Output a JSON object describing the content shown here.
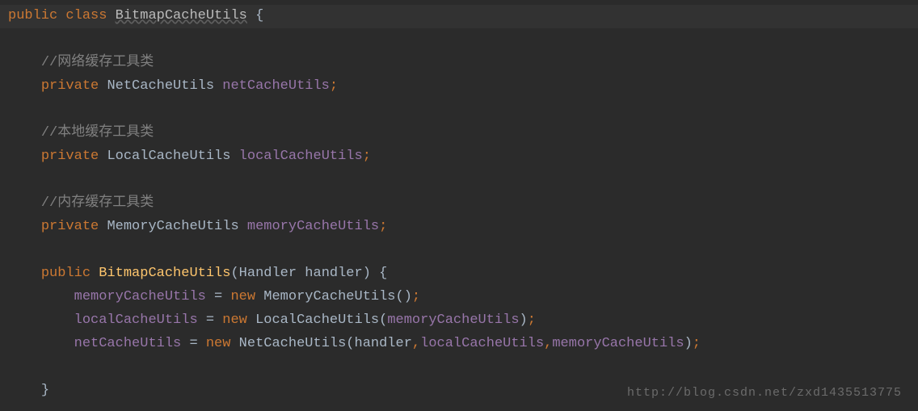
{
  "lines": {
    "l1": {
      "kw1": "public",
      "kw2": "class",
      "className": "BitmapCacheUtils",
      "brace": " {"
    },
    "l3": {
      "comment": "//网络缓存工具类"
    },
    "l4": {
      "kw": "private",
      "type": "NetCacheUtils",
      "field": "netCacheUtils",
      "semi": ";"
    },
    "l6": {
      "comment": "//本地缓存工具类"
    },
    "l7": {
      "kw": "private",
      "type": "LocalCacheUtils",
      "field": "localCacheUtils",
      "semi": ";"
    },
    "l9": {
      "comment": "//内存缓存工具类"
    },
    "l10": {
      "kw": "private",
      "type": "MemoryCacheUtils",
      "field": "memoryCacheUtils",
      "semi": ";"
    },
    "l12": {
      "kw": "public",
      "method": "BitmapCacheUtils",
      "paramType": "Handler",
      "paramName": "handler",
      "brace": " {"
    },
    "l13": {
      "field": "memoryCacheUtils",
      "eq": " = ",
      "kw": "new",
      "cls": "MemoryCacheUtils",
      "args": "()",
      "semi": ";"
    },
    "l14": {
      "field": "localCacheUtils",
      "eq": " = ",
      "kw": "new",
      "cls": "LocalCacheUtils",
      "open": "(",
      "arg1": "memoryCacheUtils",
      "close": ")",
      "semi": ";"
    },
    "l15": {
      "field": "netCacheUtils",
      "eq": " = ",
      "kw": "new",
      "cls": "NetCacheUtils",
      "open": "(",
      "arg1": "handler",
      "comma1": ",",
      "arg2": "localCacheUtils",
      "comma2": ",",
      "arg3": "memoryCacheUtils",
      "close": ")",
      "semi": ";"
    },
    "l17": {
      "brace": "}"
    }
  },
  "watermark": "http://blog.csdn.net/zxd1435513775"
}
